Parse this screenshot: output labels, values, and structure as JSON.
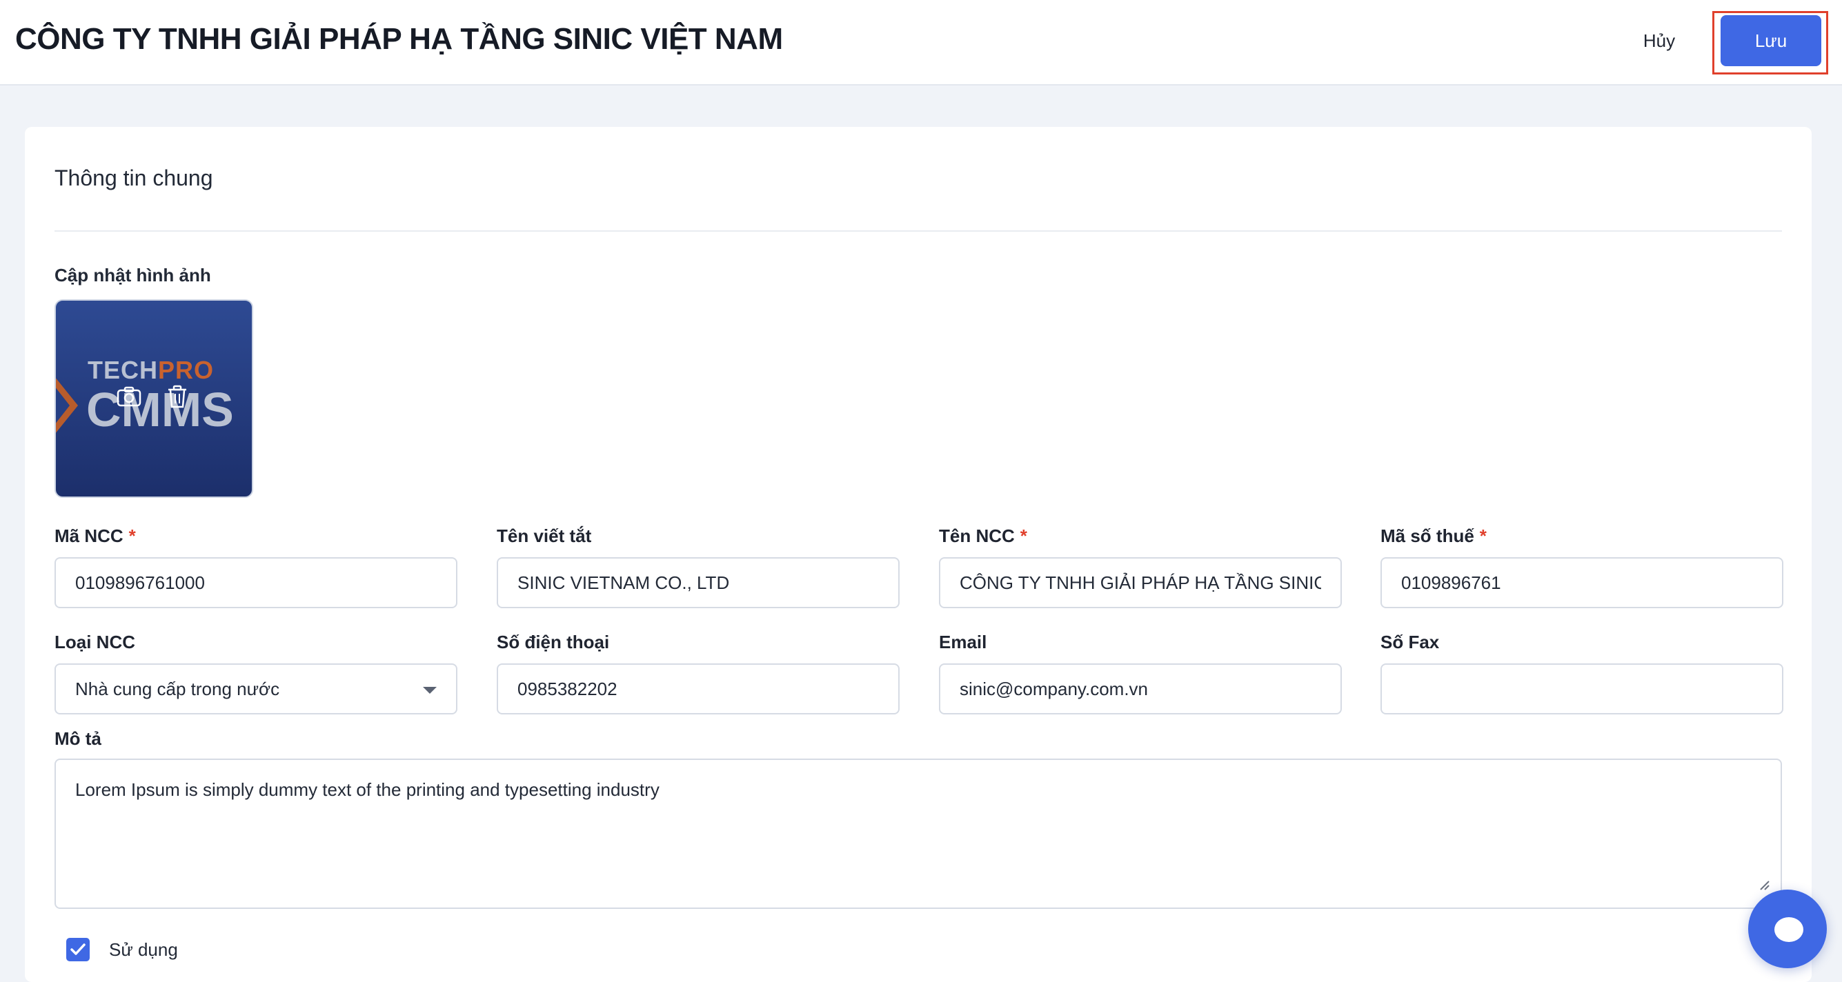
{
  "header": {
    "title": "CÔNG TY TNHH GIẢI PHÁP HẠ TẦNG SINIC VIỆT NAM",
    "cancel_label": "Hủy",
    "save_label": "Lưu"
  },
  "section": {
    "title": "Thông tin chung",
    "image_label": "Cập nhật hình ảnh",
    "logo": {
      "line1_a": "TECH",
      "line1_b": "PRO",
      "line2": "CMMS"
    }
  },
  "fields": {
    "ma_ncc": {
      "label": "Mã NCC",
      "required": "*",
      "value": "0109896761000"
    },
    "ten_viet_tat": {
      "label": "Tên viết tắt",
      "value": "SINIC VIETNAM CO., LTD"
    },
    "ten_ncc": {
      "label": "Tên NCC",
      "required": "*",
      "value": "CÔNG TY TNHH GIẢI PHÁP HẠ TẦNG SINIC"
    },
    "ma_so_thue": {
      "label": "Mã số thuế",
      "required": "*",
      "value": "0109896761"
    },
    "loai_ncc": {
      "label": "Loại NCC",
      "value": "Nhà cung cấp trong nước"
    },
    "so_dien_thoai": {
      "label": "Số điện thoại",
      "value": "0985382202"
    },
    "email": {
      "label": "Email",
      "value": "sinic@company.com.vn"
    },
    "so_fax": {
      "label": "Số Fax",
      "value": ""
    },
    "mo_ta": {
      "label": "Mô tả",
      "value": "Lorem Ipsum is simply dummy text of the printing and typesetting industry"
    }
  },
  "su_dung": {
    "label": "Sử dụng",
    "checked": true
  },
  "colors": {
    "primary": "#3f68e4",
    "required": "#e0402c",
    "highlight_border": "#e0402c"
  },
  "icons": [
    "camera-icon",
    "trash-icon",
    "chevron-down-icon",
    "check-icon",
    "chat-icon",
    "resize-handle-icon"
  ]
}
